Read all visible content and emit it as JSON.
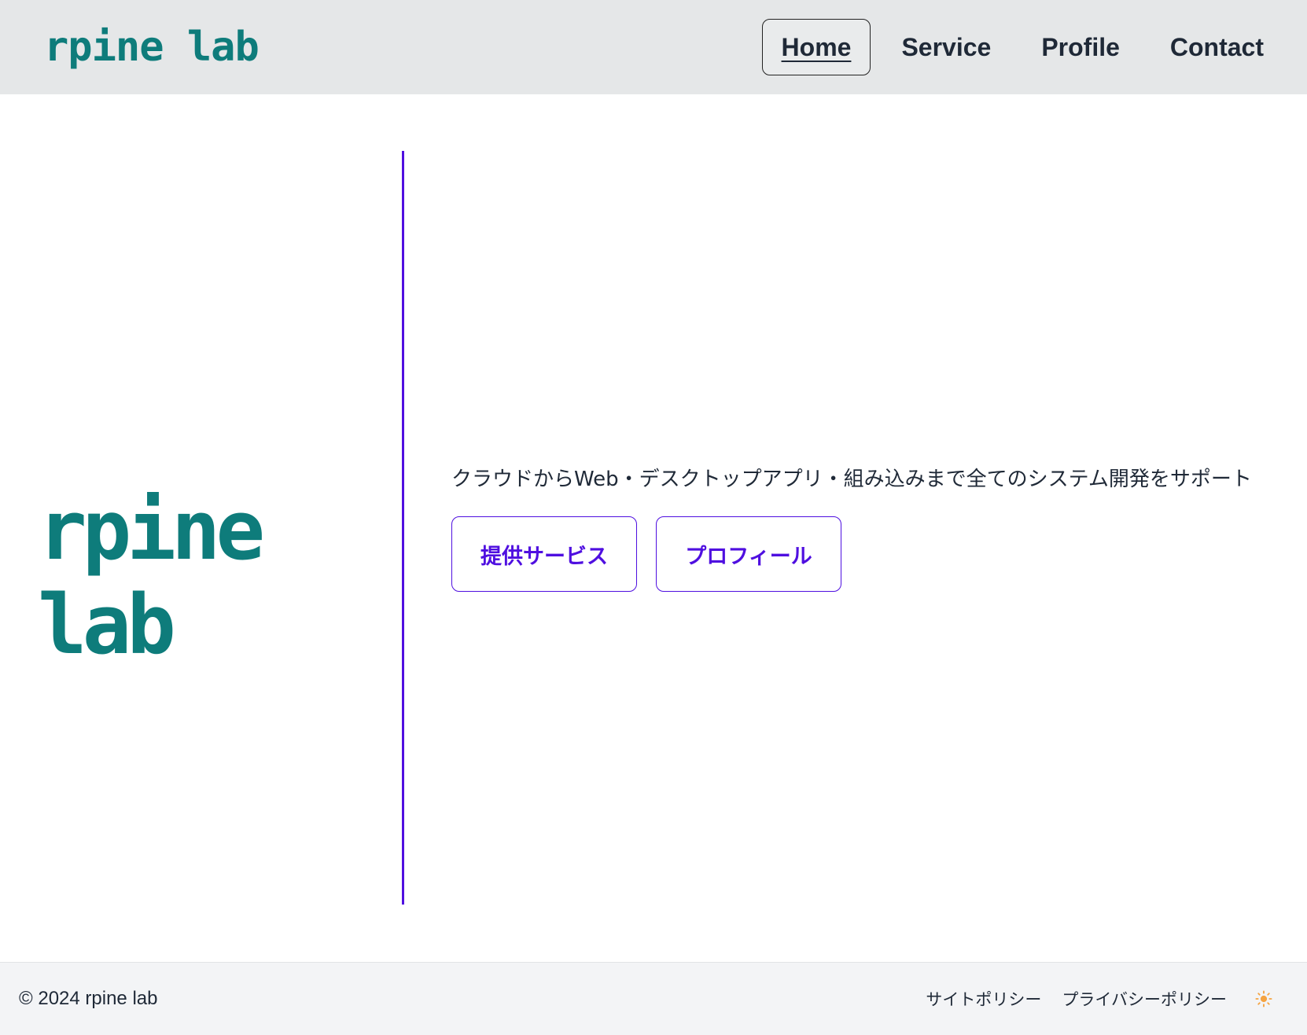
{
  "header": {
    "brand": "rpine lab",
    "nav": [
      {
        "label": "Home",
        "active": true
      },
      {
        "label": "Service",
        "active": false
      },
      {
        "label": "Profile",
        "active": false
      },
      {
        "label": "Contact",
        "active": false
      }
    ]
  },
  "hero": {
    "logo": "rpine lab",
    "tagline": "クラウドからWeb・デスクトップアプリ・組み込みまで全てのシステム開発をサポート",
    "buttons": {
      "services": "提供サービス",
      "profile": "プロフィール"
    }
  },
  "footer": {
    "copyright": "© 2024 rpine lab",
    "links": [
      "サイトポリシー",
      "プライバシーポリシー"
    ],
    "theme_toggle_icon": "sun-icon"
  },
  "colors": {
    "brand_teal": "#0e7c7b",
    "accent_purple": "#4f0fe0",
    "theme_icon_orange": "#f5a340"
  }
}
